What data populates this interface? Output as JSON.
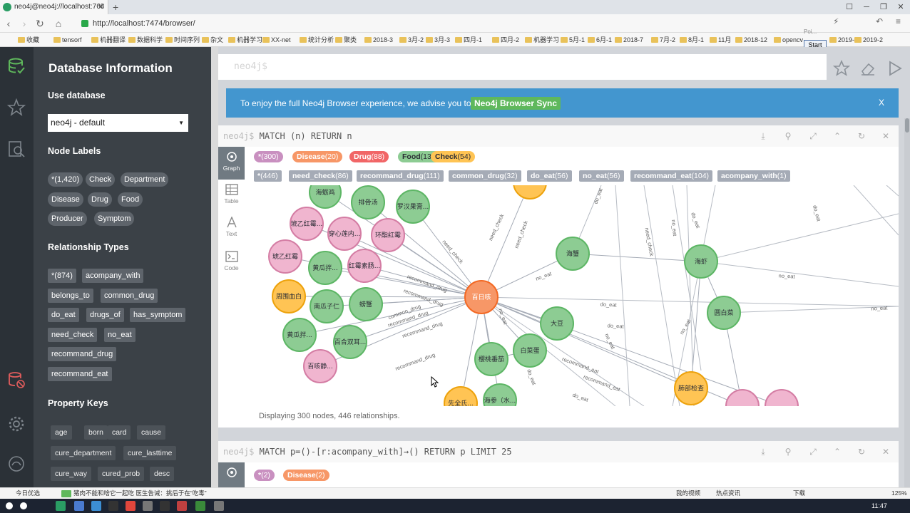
{
  "browser": {
    "tab_title": "neo4j@neo4j://localhost:7687 - Neo4j Browser",
    "tab_title_display": "neo4j@neo4j://localhost:768",
    "url": "http://localhost:7474/browser/",
    "url_host": "localhost",
    "bookmarks": [
      "收藏",
      "tensorf",
      "机器翻译",
      "数据科学",
      "时间序列",
      "杂文",
      "机器学习",
      "XX-net",
      "统计分析",
      "聚类",
      "2018-3",
      "3月-2",
      "3月-3",
      "四月-1",
      "四月-2",
      "机器学习",
      "5月-1",
      "6月-1",
      "2018-7",
      "7月-2",
      "8月-1",
      "11月",
      "2018-12",
      "opencv",
      "2019-1",
      "2019-2"
    ],
    "overlay_label": "Poi...",
    "start_button": "Start"
  },
  "drawer": {
    "title": "Database Information",
    "use_database_heading": "Use database",
    "database_selected": "neo4j - default",
    "node_labels_heading": "Node Labels",
    "node_labels": [
      "*(1,420)",
      "Check",
      "Department",
      "Disease",
      "Drug",
      "Food",
      "Producer",
      "Symptom"
    ],
    "relationship_types_heading": "Relationship Types",
    "relationship_types": [
      "*(874)",
      "acompany_with",
      "belongs_to",
      "common_drug",
      "do_eat",
      "drugs_of",
      "has_symptom",
      "need_check",
      "no_eat",
      "recommand_drug",
      "recommand_eat"
    ],
    "property_keys_heading": "Property Keys",
    "property_keys": [
      "age",
      "born",
      "card",
      "cause",
      "cure_department",
      "cure_lasttime",
      "cure_way",
      "cured_prob",
      "desc"
    ]
  },
  "editor": {
    "placeholder": "neo4j$"
  },
  "banner": {
    "message": "To enjoy the full Neo4j Browser experience, we advise you to use",
    "sync_label": "Neo4j Browser Sync",
    "close_label": "X"
  },
  "frame1": {
    "prompt": "neo4j$",
    "query": "MATCH (n) RETURN n",
    "tabs": [
      "Graph",
      "Table",
      "Text",
      "Code"
    ],
    "node_labels": [
      {
        "name": "*",
        "count": "(300)",
        "color": "#c990c0",
        "text": "#fff"
      },
      {
        "name": "Disease",
        "count": "(20)",
        "color": "#f79767",
        "text": "#fff"
      },
      {
        "name": "Drug",
        "count": "(88)",
        "color": "#f16667",
        "text": "#fff"
      },
      {
        "name": "Food",
        "count": "(138)",
        "color": "#8dcc93",
        "text": "#2a2c34"
      },
      {
        "name": "Check",
        "count": "(54)",
        "color": "#ffc454",
        "text": "#2a2c34"
      }
    ],
    "rel_types": [
      {
        "name": "*",
        "count": "(446)"
      },
      {
        "name": "need_check",
        "count": "(86)"
      },
      {
        "name": "recommand_drug",
        "count": "(111)"
      },
      {
        "name": "common_drug",
        "count": "(32)"
      },
      {
        "name": "do_eat",
        "count": "(56)"
      },
      {
        "name": "no_eat",
        "count": "(56)"
      },
      {
        "name": "recommand_eat",
        "count": "(104)"
      },
      {
        "name": "acompany_with",
        "count": "(1)"
      }
    ],
    "status": "Displaying 300 nodes, 446 relationships."
  },
  "graph": {
    "colors": {
      "Food": "#8dcc93",
      "Drug": "#f0b5cf",
      "Disease": "#f79767",
      "Check": "#ffc454"
    },
    "nodes": [
      {
        "label": "百日咳",
        "type": "Disease"
      },
      {
        "label": "海蛎鸡",
        "type": "Food"
      },
      {
        "label": "排骨汤",
        "type": "Food"
      },
      {
        "label": "罗汉果膏...",
        "type": "Food"
      },
      {
        "label": "",
        "type": "Check"
      },
      {
        "label": "琥乙红霉...",
        "type": "Drug"
      },
      {
        "label": "穿心莲内...",
        "type": "Drug"
      },
      {
        "label": "环酯红霉",
        "type": "Drug"
      },
      {
        "label": "琥乙红霉",
        "type": "Drug"
      },
      {
        "label": "黄瓜拌...",
        "type": "Food"
      },
      {
        "label": "红霉素肠...",
        "type": "Drug"
      },
      {
        "label": "周围血白",
        "type": "Check"
      },
      {
        "label": "南瓜子仁",
        "type": "Food"
      },
      {
        "label": "螃蟹",
        "type": "Food"
      },
      {
        "label": "黄瓜拌...",
        "type": "Food"
      },
      {
        "label": "百合双耳...",
        "type": "Food"
      },
      {
        "label": "百咳静...",
        "type": "Drug"
      },
      {
        "label": "海蟹",
        "type": "Food"
      },
      {
        "label": "海虾",
        "type": "Food"
      },
      {
        "label": "圆白菜",
        "type": "Food"
      },
      {
        "label": "大豆",
        "type": "Food"
      },
      {
        "label": "白菜蛋",
        "type": "Food"
      },
      {
        "label": "樱桃番茄",
        "type": "Food"
      },
      {
        "label": "海参（水...",
        "type": "Food"
      },
      {
        "label": "先全氏...",
        "type": "Check"
      },
      {
        "label": "肺部检查",
        "type": "Check"
      },
      {
        "label": "",
        "type": "Drug"
      },
      {
        "label": "",
        "type": "Drug"
      }
    ],
    "edge_labels": [
      "need_check",
      "need_check",
      "recommand_drug",
      "recommand_drug",
      "recommand_drug",
      "recommand_drug",
      "common_drug",
      "need_check",
      "no_eat",
      "do_eat",
      "no_eat",
      "no_eat",
      "do_eat",
      "no_eat",
      "need_check",
      "no_eat",
      "do_eat",
      "do_eat",
      "no_eat",
      "recommand_eat",
      "do_eat",
      "recommand_eat",
      "do_eat",
      "no_eat",
      "do_eat",
      "recommand_drug"
    ]
  },
  "frame2": {
    "prompt": "neo4j$",
    "query": "MATCH p=()-[r:acompany_with]→() RETURN p LIMIT 25",
    "node_labels": [
      {
        "name": "*",
        "count": "(2)",
        "color": "#c990c0",
        "text": "#fff"
      },
      {
        "name": "Disease",
        "count": "(2)",
        "color": "#f79767",
        "text": "#fff"
      }
    ]
  },
  "statusbar": {
    "left": "今日优选",
    "news": "猪肉不能和啥它一起吃 医生告诫：挑后于在“吃毒”",
    "items": [
      "我的视频",
      "热点资讯",
      "下载",
      "125%"
    ]
  },
  "taskbar": {
    "time": "11:47"
  }
}
